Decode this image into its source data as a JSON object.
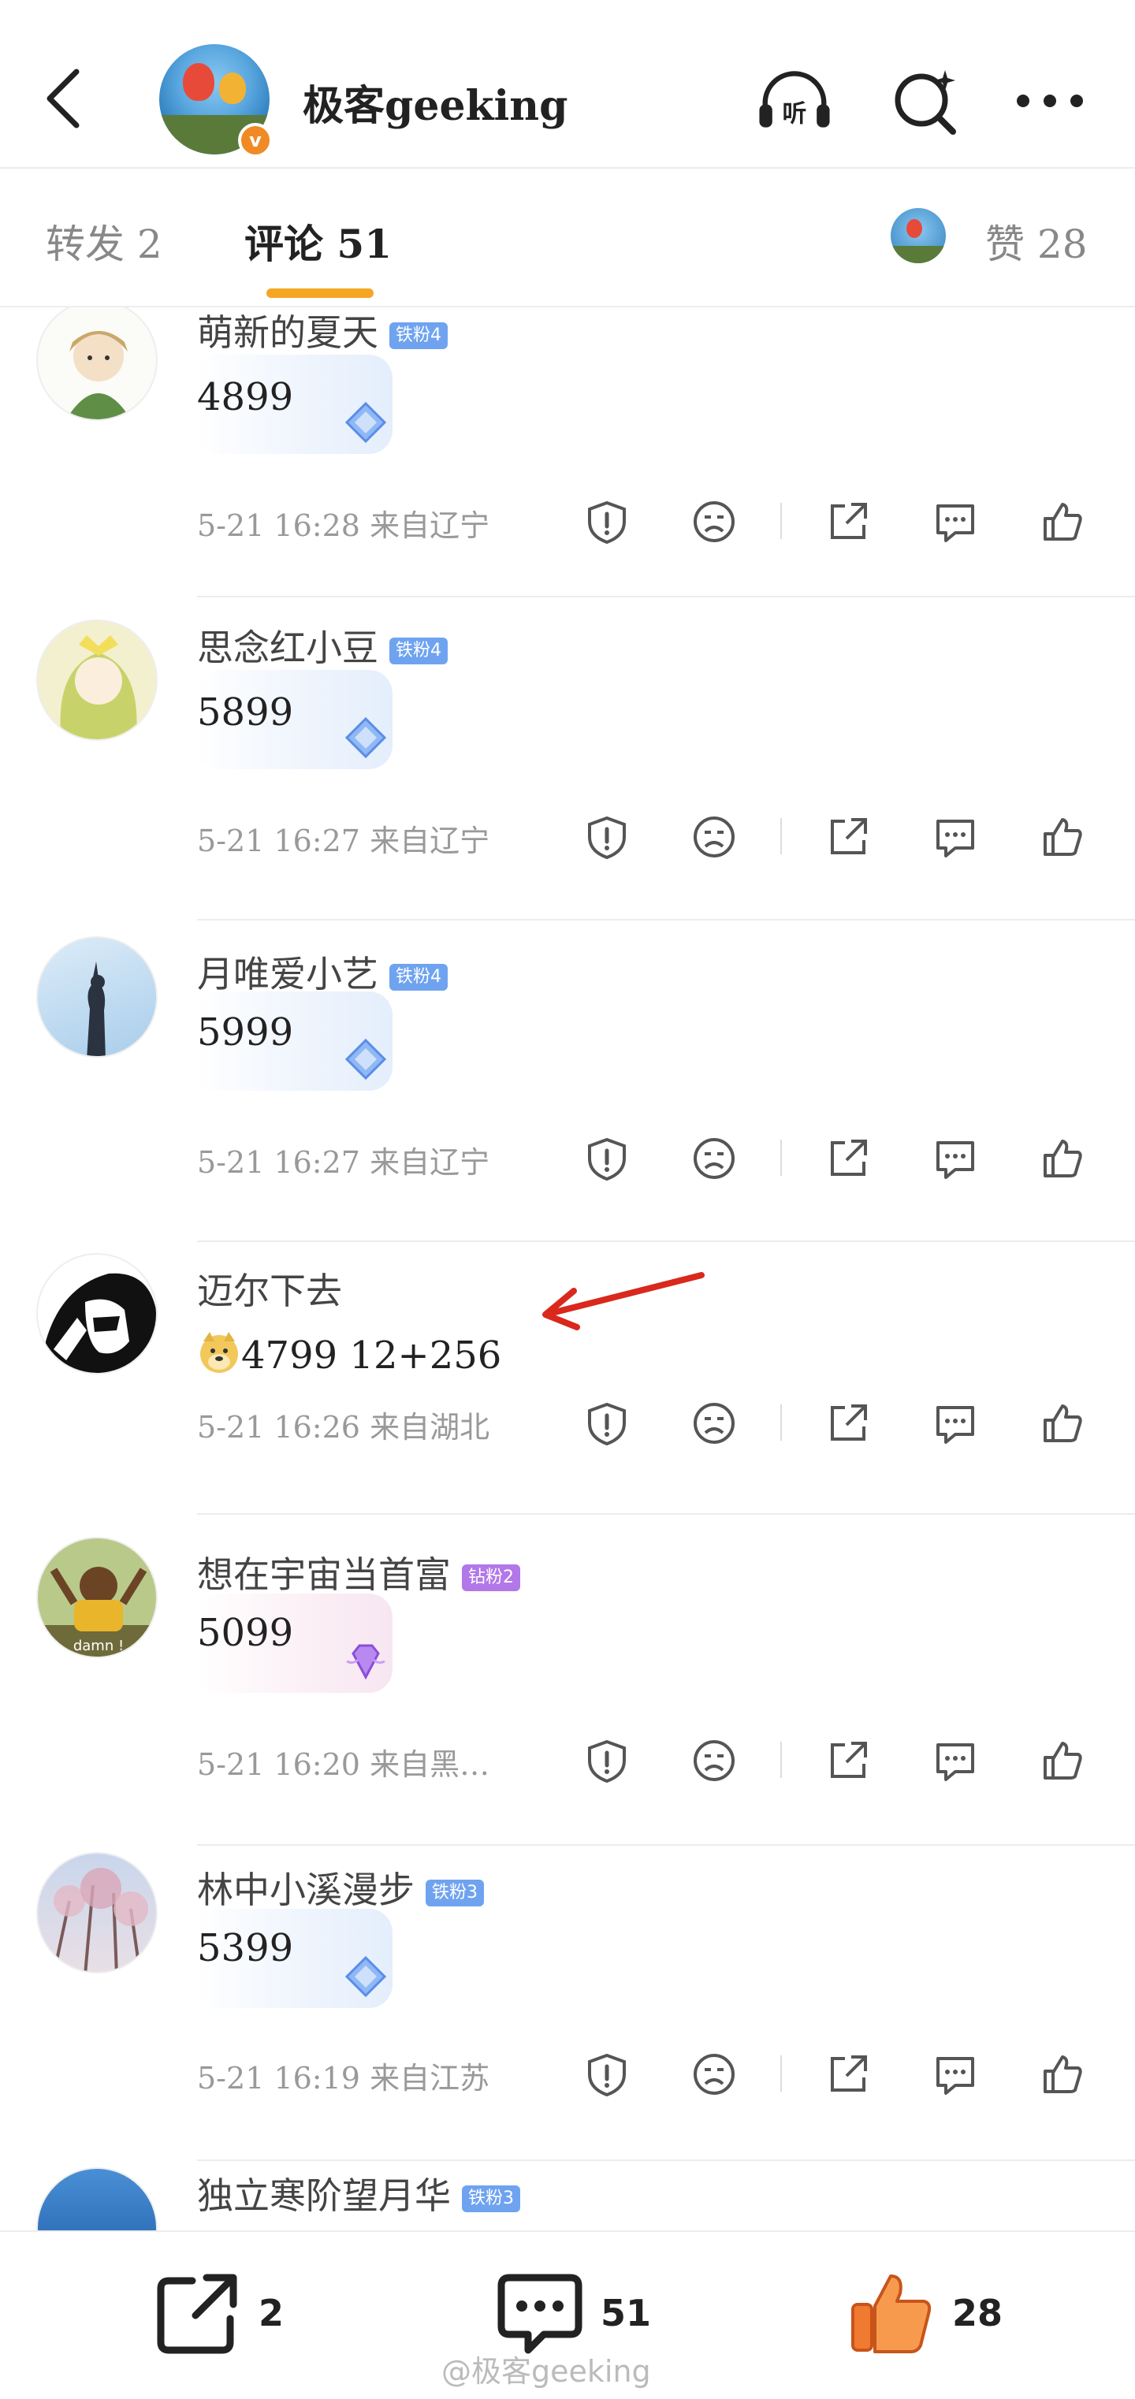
{
  "header": {
    "account_name": "极客geeking",
    "verified_mark": "v",
    "icons": [
      "back-arrow-icon",
      "headphone-listen-icon",
      "search-sparkle-icon",
      "more-dots-icon"
    ],
    "listen_label": "听"
  },
  "tabs": {
    "repost_label": "转发",
    "repost_count": "2",
    "comment_label": "评论",
    "comment_count": "51",
    "like_label": "赞",
    "like_count": "28"
  },
  "comments": [
    {
      "username": "萌新的夏天",
      "badge": "铁粉4",
      "text": "4899",
      "time": "5-21 16:28",
      "location": "来自辽宁"
    },
    {
      "username": "思念红小豆",
      "badge": "铁粉4",
      "text": "5899",
      "time": "5-21 16:27",
      "location": "来自辽宁"
    },
    {
      "username": "月唯爱小艺",
      "badge": "铁粉4",
      "text": "5999",
      "time": "5-21 16:27",
      "location": "来自辽宁"
    },
    {
      "username": "迈尔下去",
      "badge": "",
      "text": "4799 12+256",
      "time": "5-21 16:26",
      "location": "来自湖北"
    },
    {
      "username": "想在宇宙当首富",
      "badge": "钻粉2",
      "text": "5099",
      "time": "5-21 16:20",
      "location": "来自黑…"
    },
    {
      "username": "林中小溪漫步",
      "badge": "铁粉3",
      "text": "5399",
      "time": "5-21 16:19",
      "location": "来自江苏"
    },
    {
      "username": "独立寒阶望月华",
      "badge": "铁粉3",
      "text": "",
      "time": "",
      "location": ""
    }
  ],
  "comment_actions": [
    "report-icon",
    "dislike-face-icon",
    "share-icon",
    "reply-icon",
    "like-icon"
  ],
  "bottom_bar": {
    "repost_count": "2",
    "comment_count": "51",
    "like_count": "28"
  },
  "watermark": "@极客geeking",
  "colors": {
    "accent": "#f5a623",
    "like_orange": "#f07a30",
    "fan_badge_blue": "#6fa3f0",
    "fan_badge_purple": "#b277e8",
    "annotation_arrow": "#d9281c"
  }
}
